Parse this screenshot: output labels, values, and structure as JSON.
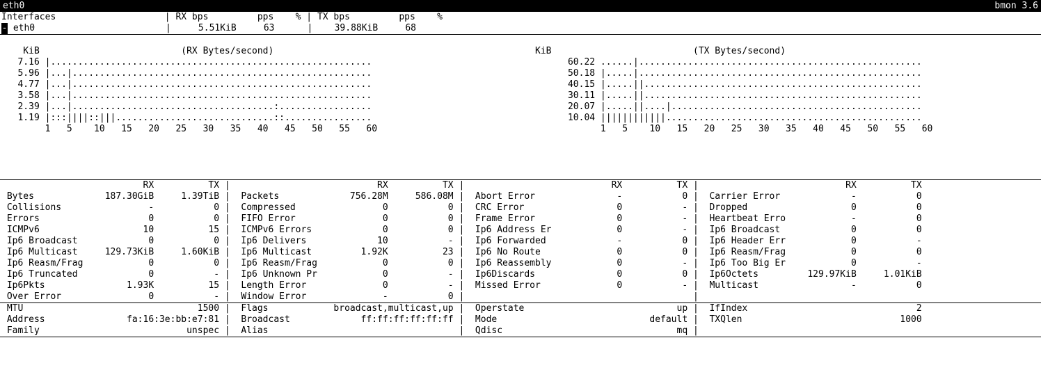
{
  "titlebar": {
    "left": "eth0",
    "right": "bmon 3.6"
  },
  "interfaces_header": {
    "label": "Interfaces",
    "cols": [
      "RX bps",
      "pps",
      "%",
      "TX bps",
      "pps",
      "%"
    ]
  },
  "interface_row": {
    "name": "eth0",
    "rx_bps": "5.51KiB",
    "rx_pps": "63",
    "rx_pct": "",
    "tx_bps": "39.88KiB",
    "tx_pps": "68",
    "tx_pct": ""
  },
  "graphs": {
    "unit": "KiB",
    "rx_title": "(RX Bytes/second)",
    "tx_title": "(TX Bytes/second)",
    "rx_y": [
      "7.16",
      "5.96",
      "4.77",
      "3.58",
      "2.39",
      "1.19"
    ],
    "tx_y": [
      "60.22",
      "50.18",
      "40.15",
      "30.11",
      "20.07",
      "10.04"
    ],
    "x_ticks": [
      "1",
      "5",
      "10",
      "15",
      "20",
      "25",
      "30",
      "35",
      "40",
      "45",
      "50",
      "55",
      "60"
    ],
    "rx_rows": [
      "|...........................................................",
      "|...|.......................................................",
      "|...|.......................................................",
      "|...|.......................................................",
      "|...|.....................................:.................",
      "|:::||||::|||.............................::................"
    ],
    "tx_rows": [
      "......|....................................................",
      "|.....|....................................................",
      "|.....||...................................................",
      "|.....||...................................................",
      "|.....||....|..............................................",
      "||||||||||||..............................................."
    ]
  },
  "stats": {
    "headers": {
      "rx": "RX",
      "tx": "TX"
    },
    "col1": [
      {
        "label": "Bytes",
        "rx": "187.30GiB",
        "tx": "1.39TiB"
      },
      {
        "label": "Collisions",
        "rx": "-",
        "tx": "0"
      },
      {
        "label": "Errors",
        "rx": "0",
        "tx": "0"
      },
      {
        "label": "ICMPv6",
        "rx": "10",
        "tx": "15"
      },
      {
        "label": "Ip6 Broadcast",
        "rx": "0",
        "tx": "0"
      },
      {
        "label": "Ip6 Multicast",
        "rx": "129.73KiB",
        "tx": "1.60KiB"
      },
      {
        "label": "Ip6 Reasm/Frag",
        "rx": "0",
        "tx": "0"
      },
      {
        "label": "Ip6 Truncated",
        "rx": "0",
        "tx": "-"
      },
      {
        "label": "Ip6Pkts",
        "rx": "1.93K",
        "tx": "15"
      },
      {
        "label": "Over Error",
        "rx": "0",
        "tx": "-"
      }
    ],
    "col2": [
      {
        "label": "Packets",
        "rx": "756.28M",
        "tx": "586.08M"
      },
      {
        "label": "Compressed",
        "rx": "0",
        "tx": "0"
      },
      {
        "label": "FIFO Error",
        "rx": "0",
        "tx": "0"
      },
      {
        "label": "ICMPv6 Errors",
        "rx": "0",
        "tx": "0"
      },
      {
        "label": "Ip6 Delivers",
        "rx": "10",
        "tx": "-"
      },
      {
        "label": "Ip6 Multicast",
        "rx": "1.92K",
        "tx": "23"
      },
      {
        "label": "Ip6 Reasm/Frag",
        "rx": "0",
        "tx": "0"
      },
      {
        "label": "Ip6 Unknown Pr",
        "rx": "0",
        "tx": "-"
      },
      {
        "label": "Length Error",
        "rx": "0",
        "tx": "-"
      },
      {
        "label": "Window Error",
        "rx": "-",
        "tx": "0"
      }
    ],
    "col3": [
      {
        "label": "Abort Error",
        "rx": "-",
        "tx": "0"
      },
      {
        "label": "CRC Error",
        "rx": "0",
        "tx": "-"
      },
      {
        "label": "Frame Error",
        "rx": "0",
        "tx": "-"
      },
      {
        "label": "Ip6 Address Er",
        "rx": "0",
        "tx": "-"
      },
      {
        "label": "Ip6 Forwarded",
        "rx": "-",
        "tx": "0"
      },
      {
        "label": "Ip6 No Route",
        "rx": "0",
        "tx": "0"
      },
      {
        "label": "Ip6 Reassembly",
        "rx": "0",
        "tx": "-"
      },
      {
        "label": "Ip6Discards",
        "rx": "0",
        "tx": "0"
      },
      {
        "label": "Missed Error",
        "rx": "0",
        "tx": "-"
      }
    ],
    "col4": [
      {
        "label": "Carrier Error",
        "rx": "-",
        "tx": "0"
      },
      {
        "label": "Dropped",
        "rx": "0",
        "tx": "0"
      },
      {
        "label": "Heartbeat Erro",
        "rx": "-",
        "tx": "0"
      },
      {
        "label": "Ip6 Broadcast",
        "rx": "0",
        "tx": "0"
      },
      {
        "label": "Ip6 Header Err",
        "rx": "0",
        "tx": "-"
      },
      {
        "label": "Ip6 Reasm/Frag",
        "rx": "0",
        "tx": "0"
      },
      {
        "label": "Ip6 Too Big Er",
        "rx": "0",
        "tx": "-"
      },
      {
        "label": "Ip6Octets",
        "rx": "129.97KiB",
        "tx": "1.01KiB"
      },
      {
        "label": "Multicast",
        "rx": "-",
        "tx": "0"
      }
    ]
  },
  "info": {
    "col1": [
      {
        "label": "MTU",
        "value": "1500"
      },
      {
        "label": "Address",
        "value": "fa:16:3e:bb:e7:81"
      },
      {
        "label": "Family",
        "value": "unspec"
      }
    ],
    "col2": [
      {
        "label": "Flags",
        "value": "broadcast,multicast,up"
      },
      {
        "label": "Broadcast",
        "value": "ff:ff:ff:ff:ff:ff"
      },
      {
        "label": "Alias",
        "value": ""
      }
    ],
    "col3": [
      {
        "label": "Operstate",
        "value": "up"
      },
      {
        "label": "Mode",
        "value": "default"
      },
      {
        "label": "Qdisc",
        "value": "mq"
      }
    ],
    "col4": [
      {
        "label": "IfIndex",
        "value": "2"
      },
      {
        "label": "TXQlen",
        "value": "1000"
      },
      {
        "label": "",
        "value": ""
      }
    ]
  }
}
